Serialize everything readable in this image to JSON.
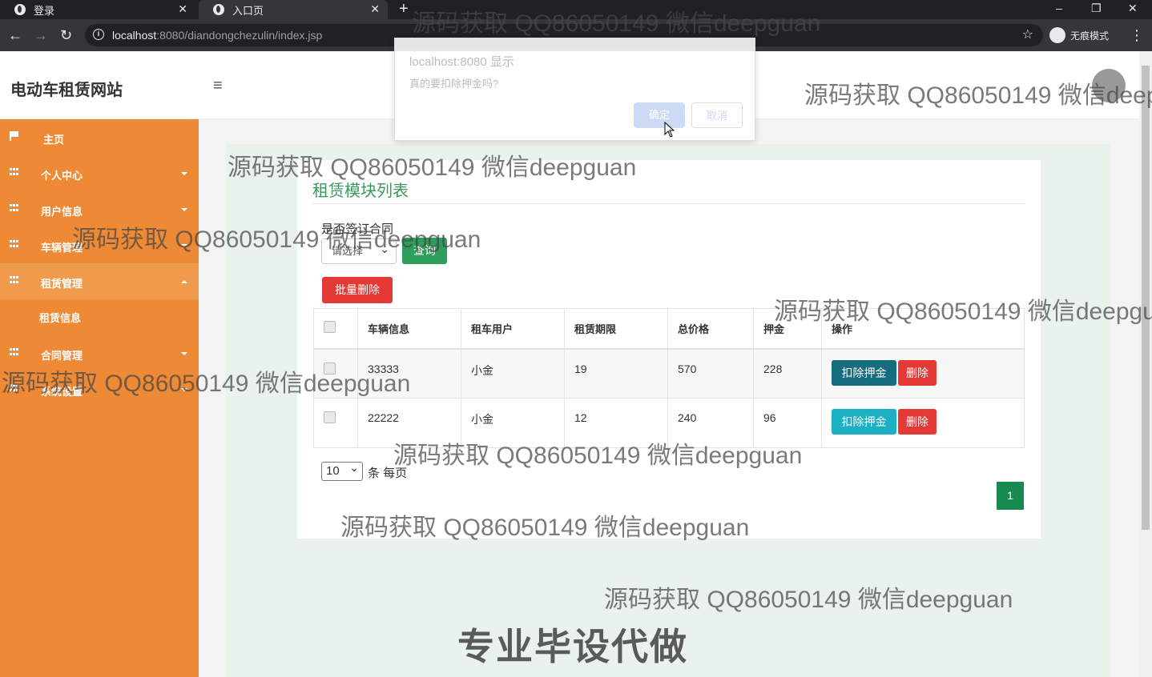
{
  "browser": {
    "tabs": [
      {
        "label": "登录",
        "active": false
      },
      {
        "label": "入口页",
        "active": true
      }
    ],
    "new_tab": "+",
    "window_controls": {
      "minimize": "–",
      "restore": "❐",
      "close": "✕"
    },
    "url_host": "localhost",
    "url_rest": ":8080/diandongchezulin/index.jsp",
    "incognito_label": "无痕模式"
  },
  "header": {
    "site_title": "电动车租赁网站",
    "menu_toggle": "≡"
  },
  "sidebar": {
    "items": [
      {
        "label": "主页",
        "icon": "flag-icon",
        "has_caret": false
      },
      {
        "label": "个人中心",
        "icon": "grid-icon",
        "has_caret": true
      },
      {
        "label": "用户信息",
        "icon": "grid-icon",
        "has_caret": true
      },
      {
        "label": "车辆管理",
        "icon": "grid-icon",
        "has_caret": true
      },
      {
        "label": "租赁管理",
        "icon": "grid-icon",
        "has_caret": true,
        "expanded": true
      },
      {
        "label": "合同管理",
        "icon": "grid-icon",
        "has_caret": true
      },
      {
        "label": "系统设置",
        "icon": "grid-icon",
        "has_caret": true
      }
    ],
    "sub_item": "租赁信息"
  },
  "main": {
    "title": "租赁模块列表",
    "filter": {
      "label": "是否签订合同",
      "select_value": "请选择",
      "query_button": "查询"
    },
    "batch_delete": "批量删除",
    "table": {
      "headers": [
        "",
        "车辆信息",
        "租车用户",
        "租赁期限",
        "总价格",
        "押金",
        "操作"
      ],
      "rows": [
        {
          "vehicle": "33333",
          "user": "小金",
          "term": "19",
          "total": "570",
          "deposit": "228"
        },
        {
          "vehicle": "22222",
          "user": "小金",
          "term": "12",
          "total": "240",
          "deposit": "96"
        }
      ],
      "deduct_button": "扣除押金",
      "delete_button": "删除"
    },
    "pager": {
      "page_size": "10",
      "per_page_text": "条 每页",
      "current_page": "1"
    }
  },
  "dialog": {
    "origin": "localhost:8080 显示",
    "message": "真的要扣除押金吗?",
    "ok": "确定",
    "cancel": "取消"
  },
  "watermarks": {
    "text": "源码获取 QQ86050149 微信deepguan",
    "banner": "专业毕设代做"
  },
  "colors": {
    "sidebar": "#ee8a35",
    "title_green": "#3a9a5c",
    "query_green": "#2e9e5b",
    "danger": "#e53935",
    "info": "#1bb0c4"
  }
}
